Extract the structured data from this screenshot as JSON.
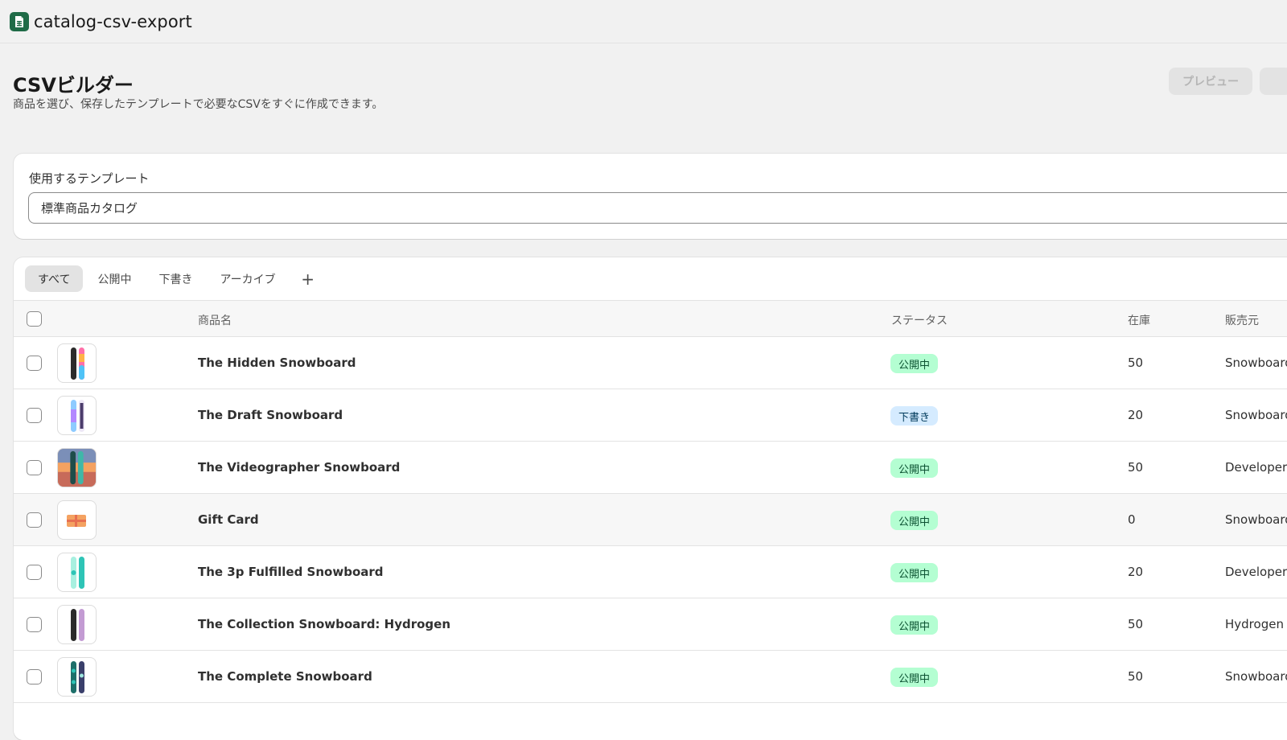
{
  "app": {
    "title": "catalog-csv-export",
    "icon": "spreadsheet-icon",
    "accent": "#1f6b47"
  },
  "header": {
    "title": "CSVビルダー",
    "description": "商品を選び、保存したテンプレートで必要なCSVをすぐに作成できます。",
    "preview_label": "プレビュー"
  },
  "template": {
    "label": "使用するテンプレート",
    "selected": "標準商品カタログ"
  },
  "tabs": [
    {
      "label": "すべて",
      "active": true
    },
    {
      "label": "公開中",
      "active": false
    },
    {
      "label": "下書き",
      "active": false
    },
    {
      "label": "アーカイブ",
      "active": false
    }
  ],
  "add_tab_label": "+",
  "table": {
    "columns": {
      "name": "商品名",
      "status": "ステータス",
      "stock": "在庫",
      "vendor": "販売元"
    },
    "rows": [
      {
        "name": "The Hidden Snowboard",
        "status": "公開中",
        "status_type": "active",
        "stock": "50",
        "vendor": "Snowboard Vendor",
        "thumb": "snowboard-pink-image"
      },
      {
        "name": "The Draft Snowboard",
        "status": "下書き",
        "status_type": "draft",
        "stock": "20",
        "vendor": "Snowboard Vendor",
        "thumb": "snowboard-purple-image"
      },
      {
        "name": "The Videographer Snowboard",
        "status": "公開中",
        "status_type": "active",
        "stock": "50",
        "vendor": "Developer",
        "thumb": "snowboard-photo-image"
      },
      {
        "name": "Gift Card",
        "status": "公開中",
        "status_type": "active",
        "stock": "0",
        "vendor": "Snowboard Vendor",
        "thumb": "gift-card-image"
      },
      {
        "name": "The 3p Fulfilled Snowboard",
        "status": "公開中",
        "status_type": "active",
        "stock": "20",
        "vendor": "Developer",
        "thumb": "snowboard-teal-image"
      },
      {
        "name": "The Collection Snowboard: Hydrogen",
        "status": "公開中",
        "status_type": "active",
        "stock": "50",
        "vendor": "Hydrogen Vendor",
        "thumb": "snowboard-black-purple-image"
      },
      {
        "name": "The Complete Snowboard",
        "status": "公開中",
        "status_type": "active",
        "stock": "50",
        "vendor": "Snowboard Vendor",
        "thumb": "snowboard-teal-pattern-image"
      }
    ]
  },
  "colors": {
    "status_active_bg": "#b4fed2",
    "status_draft_bg": "#d5ebff"
  }
}
